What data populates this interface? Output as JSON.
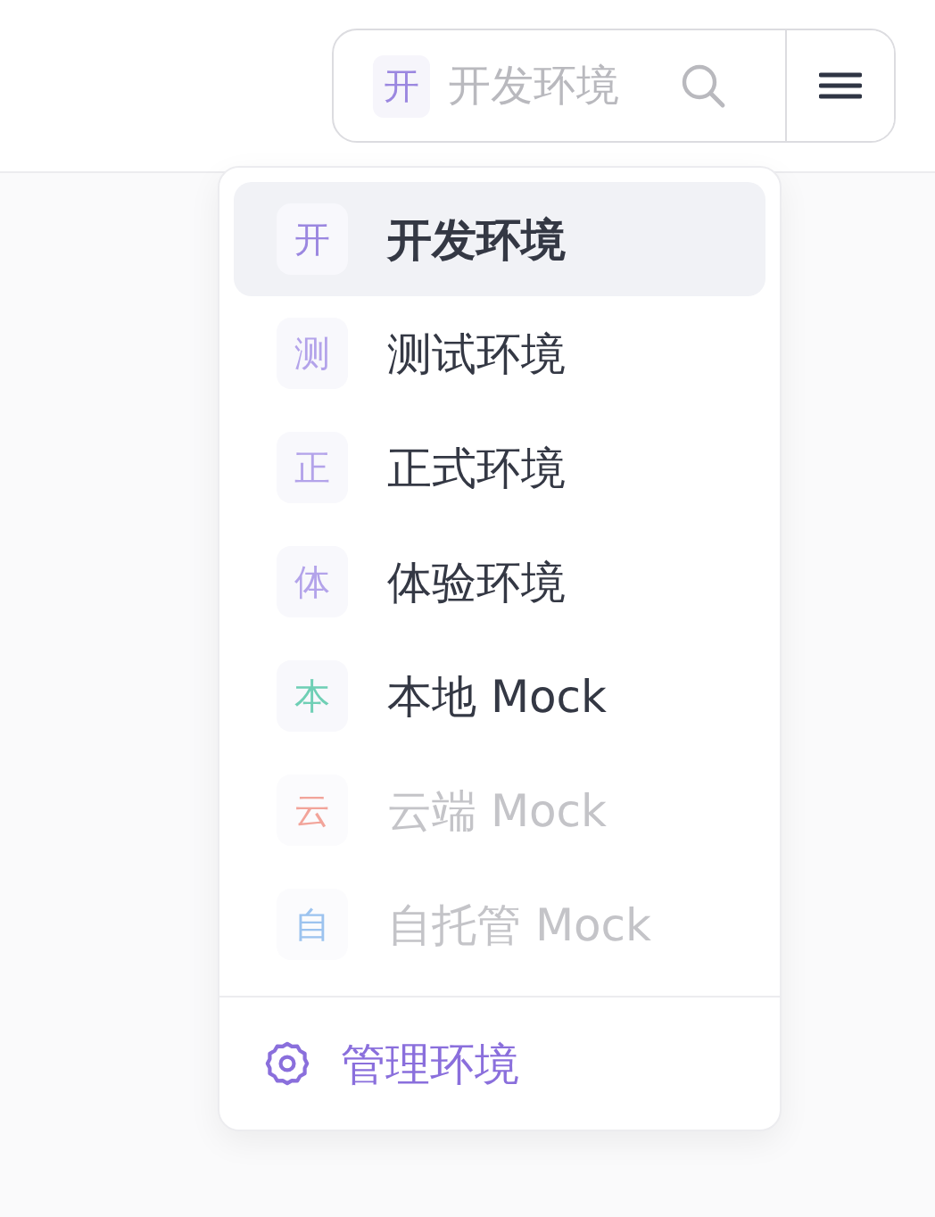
{
  "search": {
    "badge": "开",
    "color": "#9b87e0",
    "placeholder": "开发环境"
  },
  "menu": {
    "items": [
      {
        "badge": "开",
        "label": "开发环境",
        "color": "#9b87e0",
        "selected": true,
        "disabled": false
      },
      {
        "badge": "测",
        "label": "测试环境",
        "color": "#b3a3ea",
        "selected": false,
        "disabled": false
      },
      {
        "badge": "正",
        "label": "正式环境",
        "color": "#b3a3ea",
        "selected": false,
        "disabled": false
      },
      {
        "badge": "体",
        "label": "体验环境",
        "color": "#b3a3ea",
        "selected": false,
        "disabled": false
      },
      {
        "badge": "本",
        "label": "本地 Mock",
        "color": "#6fcfb5",
        "selected": false,
        "disabled": false
      },
      {
        "badge": "云",
        "label": "云端 Mock",
        "color": "#f2a49a",
        "selected": false,
        "disabled": true
      },
      {
        "badge": "自",
        "label": "自托管 Mock",
        "color": "#9cc3ef",
        "selected": false,
        "disabled": true
      }
    ],
    "footer": "管理环境"
  }
}
